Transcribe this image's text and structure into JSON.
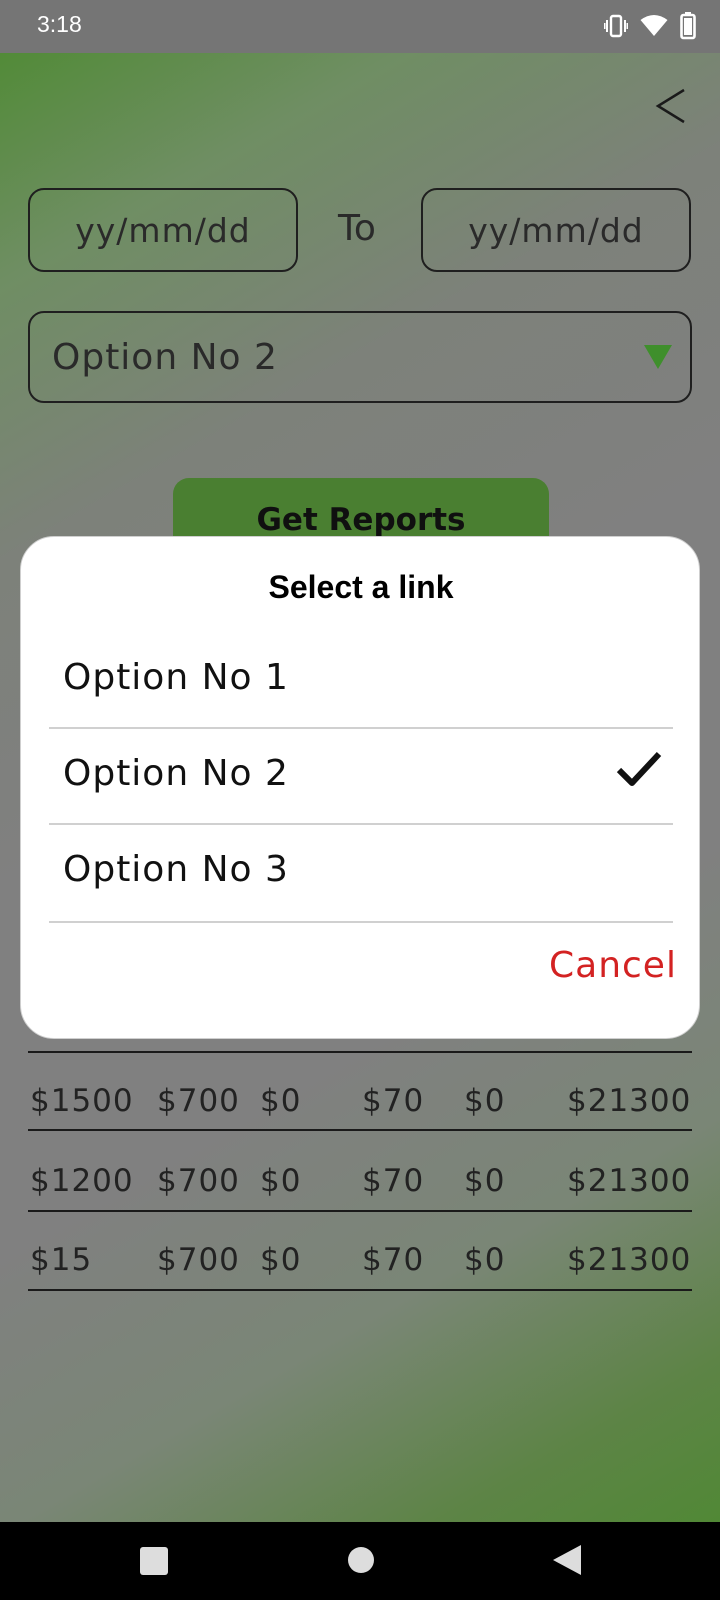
{
  "status": {
    "time": "3:18",
    "icons": [
      "vibrate-icon",
      "wifi-icon",
      "battery-icon"
    ]
  },
  "header": {
    "back_icon": "chevron-left-icon"
  },
  "filters": {
    "from_placeholder": "yy/mm/dd",
    "to_label": "To",
    "to_placeholder": "yy/mm/dd",
    "dropdown_value": "Option No 2",
    "dropdown_icon": "triangle-down-icon"
  },
  "get_reports_label": "Get Reports",
  "table": {
    "rows": [
      [
        "$1500",
        "$700",
        "$0",
        "$70",
        "$0",
        "$21300"
      ],
      [
        "$1200",
        "$700",
        "$0",
        "$70",
        "$0",
        "$21300"
      ],
      [
        "$15",
        "$700",
        "$0",
        "$70",
        "$0",
        "$21300"
      ]
    ]
  },
  "dialog": {
    "title": "Select a link",
    "options": [
      {
        "label": "Option No 1",
        "selected": false
      },
      {
        "label": "Option No 2",
        "selected": true
      },
      {
        "label": "Option No 3",
        "selected": false
      }
    ],
    "cancel_label": "Cancel"
  },
  "colors": {
    "accent_green": "#4a7f31",
    "cancel_red": "#d32222",
    "arrow_green": "#3f8f2c"
  },
  "navbar": {
    "icons": [
      "recents-square-icon",
      "home-circle-icon",
      "back-triangle-icon"
    ]
  }
}
